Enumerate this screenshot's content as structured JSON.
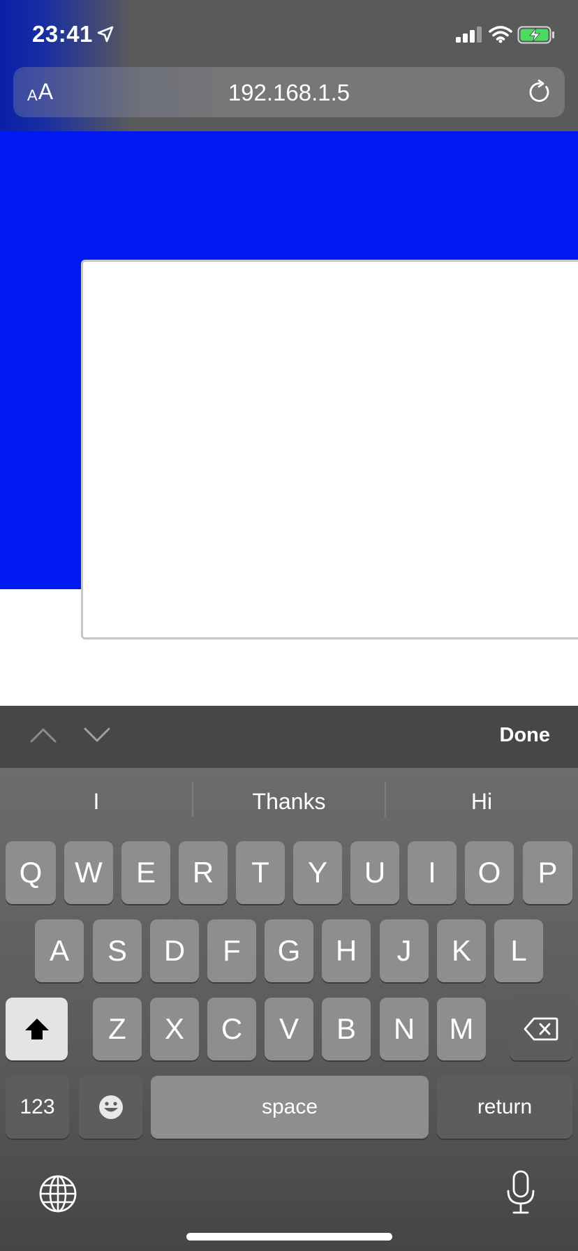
{
  "status_bar": {
    "time": "23:41",
    "icons": [
      "location-arrow-icon",
      "cellular-signal-icon",
      "wifi-icon",
      "battery-charging-icon"
    ],
    "battery_color": "#4cd964"
  },
  "address_bar": {
    "text_size_label_small": "A",
    "text_size_label_large": "A",
    "url": "192.168.1.5"
  },
  "colors": {
    "page_blue": "#0019f0",
    "keyboard_key": "#8e8e8e",
    "keyboard_key_dark": "#5d5d5d"
  },
  "accessory_bar": {
    "done_label": "Done"
  },
  "keyboard": {
    "suggestions": [
      "I",
      "Thanks",
      "Hi"
    ],
    "row1": [
      "Q",
      "W",
      "E",
      "R",
      "T",
      "Y",
      "U",
      "I",
      "O",
      "P"
    ],
    "row2": [
      "A",
      "S",
      "D",
      "F",
      "G",
      "H",
      "J",
      "K",
      "L"
    ],
    "row3": [
      "Z",
      "X",
      "C",
      "V",
      "B",
      "N",
      "M"
    ],
    "numbers_label": "123",
    "space_label": "space",
    "return_label": "return"
  }
}
